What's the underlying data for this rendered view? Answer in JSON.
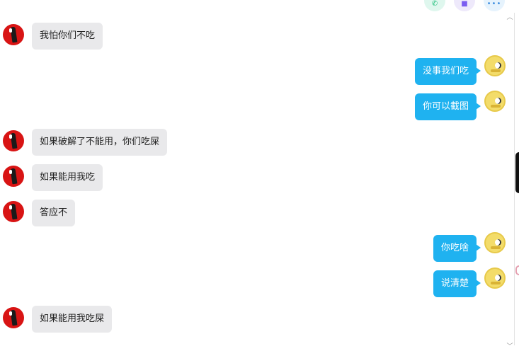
{
  "header": {
    "phone_icon": "phone-icon",
    "video_icon": "video-call-icon",
    "more_icon": "more-dots-icon"
  },
  "messages": [
    {
      "side": "left",
      "text": "我怕你们不吃"
    },
    {
      "side": "right",
      "text": "没事我们吃"
    },
    {
      "side": "right",
      "text": "你可以截图"
    },
    {
      "side": "left",
      "text": "如果破解了不能用，你们吃屎"
    },
    {
      "side": "left",
      "text": "如果能用我吃"
    },
    {
      "side": "left",
      "text": "答应不"
    },
    {
      "side": "right",
      "text": "你吃啥"
    },
    {
      "side": "right",
      "text": "说清楚"
    },
    {
      "side": "left",
      "text": "如果能用我吃屎"
    }
  ],
  "colors": {
    "outgoing_bubble": "#1fb2f0",
    "incoming_bubble": "#e9e9eb",
    "left_avatar": "#d81414",
    "right_avatar": "#f3dc6a"
  }
}
